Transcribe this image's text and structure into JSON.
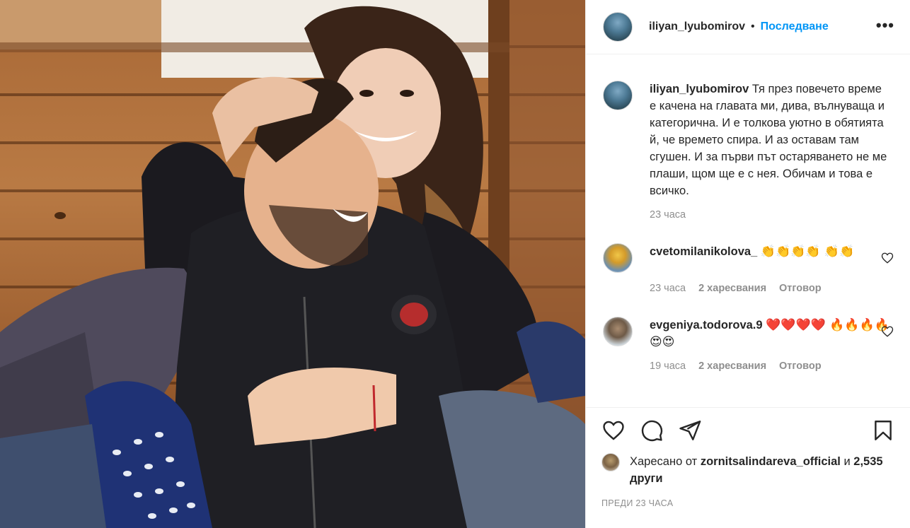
{
  "post": {
    "username": "iliyan_lyubomirov",
    "dot": "•",
    "follow_label": "Последване",
    "more_label": "•••"
  },
  "caption": {
    "username": "iliyan_lyubomirov",
    "text": "Тя през повечето време е качена на главата ми, дива, вълнуваща и категорична. И е толкова уютно в обятията й, че времето спира. И аз оставам там сгушен. И за първи път остаряването не ме плаши, щом ще е с нея. Обичам и това е всичко.",
    "time": "23 часа"
  },
  "comments": [
    {
      "username": "cvetomilanikolova_",
      "emojis": "👏👏👏👏 👏👏",
      "time": "23 часа",
      "likes": "2 харесвания",
      "reply": "Отговор"
    },
    {
      "username": "evgeniya.todorova.9",
      "emojis": "❤️❤️❤️❤️ 🔥🔥🔥🔥😍😍",
      "time": "19 часа",
      "likes": "2 харесвания",
      "reply": "Отговор"
    }
  ],
  "likes": {
    "prefix": "Харесано от",
    "user": "zornitsalindareva_official",
    "and": "и",
    "others": "2,535 други"
  },
  "timeago": "ПРЕДИ 23 ЧАСА",
  "icons": {
    "like": "heart-icon",
    "comment": "comment-icon",
    "share": "share-icon",
    "save": "bookmark-icon",
    "more": "more-icon"
  },
  "colors": {
    "follow": "#0095f6",
    "muted": "#8e8e8e",
    "text": "#262626",
    "border": "#efefef"
  }
}
